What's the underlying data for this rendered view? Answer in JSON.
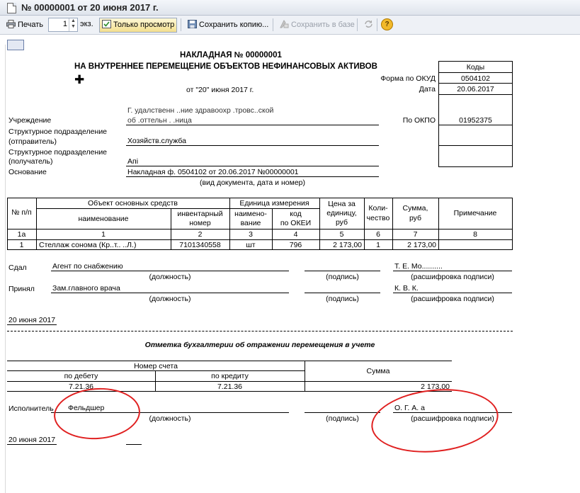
{
  "window": {
    "title": "№ 00000001 от 20 июня 2017 г."
  },
  "toolbar": {
    "print_label": "Печать",
    "copies_value": "1",
    "copies_unit": "экз.",
    "view_only_label": "Только просмотр",
    "save_copy_label": "Сохранить копию...",
    "save_db_label": "Сохранить в базе",
    "help_symbol": "?"
  },
  "doc": {
    "title_line1": "НАКЛАДНАЯ № 00000001",
    "title_line2": "НА ВНУТРЕННЕЕ ПЕРЕМЕЩЕНИЕ ОБЪЕКТОВ НЕФИНАНСОВЫХ АКТИВОВ",
    "date_line": "от \"20\" июня 2017 г.",
    "codes_header": "Коды",
    "okud_label": "Форма по ОКУД",
    "okud_value": "0504102",
    "date_label": "Дата",
    "date_value": "20.06.2017",
    "okpo_label": "По ОКПО",
    "okpo_value": "01952375",
    "institution_label": "Учреждение",
    "institution_value_1": "Г.  удалственн           ..ние здравоохр         .тровс..ской",
    "institution_value_2": "об                    .оттельн       .                .ница",
    "dept_sender_label_1": "Структурное подразделение",
    "dept_sender_label_2": "(отправитель)",
    "dept_sender_value": "Хозяйств.служба",
    "dept_receiver_label_1": "Структурное подразделение",
    "dept_receiver_label_2": "(получатель)",
    "dept_receiver_value": "Апі",
    "basis_label": "Основание",
    "basis_value": "Накладная ф. 0504102 от 20.06.2017 №00000001",
    "basis_hint": "(вид документа, дата и номер)"
  },
  "table": {
    "h_num": "№ п/п",
    "h_object": "Объект основных средств",
    "h_name": "наименование",
    "h_inv_1": "инвентарный",
    "h_inv_2": "номер",
    "h_unit": "Единица измерения",
    "h_unit_name_1": "наимено-",
    "h_unit_name_2": "вание",
    "h_unit_code_1": "код",
    "h_unit_code_2": "по ОКЕИ",
    "h_price_1": "Цена за",
    "h_price_2": "единицу,",
    "h_price_3": "руб",
    "h_qty_1": "Коли-",
    "h_qty_2": "чество",
    "h_sum_1": "Сумма,",
    "h_sum_2": "руб",
    "h_note": "Примечание",
    "idx": [
      "1а",
      "1",
      "2",
      "3",
      "4",
      "5",
      "6",
      "7",
      "8"
    ],
    "rows": [
      {
        "num": "1",
        "name": "Стеллаж сонома (Кр..т.. ..Л.)",
        "inv": "7101340558",
        "unit": "шт",
        "code": "796",
        "price": "2 173,00",
        "qty": "1",
        "sum": "2 173,00",
        "note": ""
      }
    ]
  },
  "signatures": {
    "gave_label": "Сдал",
    "gave_position": "Агент по снабжению",
    "gave_name": "Т. Е. Мо..........",
    "received_label": "Принял",
    "received_position": "Зам.главного врача",
    "received_name": "К. В. К.",
    "position_hint": "(должность)",
    "signature_hint": "(подпись)",
    "decode_hint": "(расшифровка подписи)",
    "date": "20 июня 2017"
  },
  "accounting": {
    "title": "Отметка бухгалтерии об отражении перемещения в учете",
    "account_header": "Номер счета",
    "debit_label": "по дебету",
    "credit_label": "по кредиту",
    "sum_label": "Сумма",
    "debit_value": "7.21.36",
    "credit_value": "7.21.36",
    "sum_value": "2 173,00",
    "executor_label": "Исполнитель",
    "executor_position": "Фельдшер",
    "executor_name": "О. Г. А.          а",
    "position_hint": "(должность)",
    "signature_hint": "(подпись)",
    "decode_hint": "(расшифровка подписи)",
    "date": "20 июня 2017"
  },
  "colors": {
    "annotation": "#e02020",
    "toolbar_bg": "#eef1f6"
  }
}
